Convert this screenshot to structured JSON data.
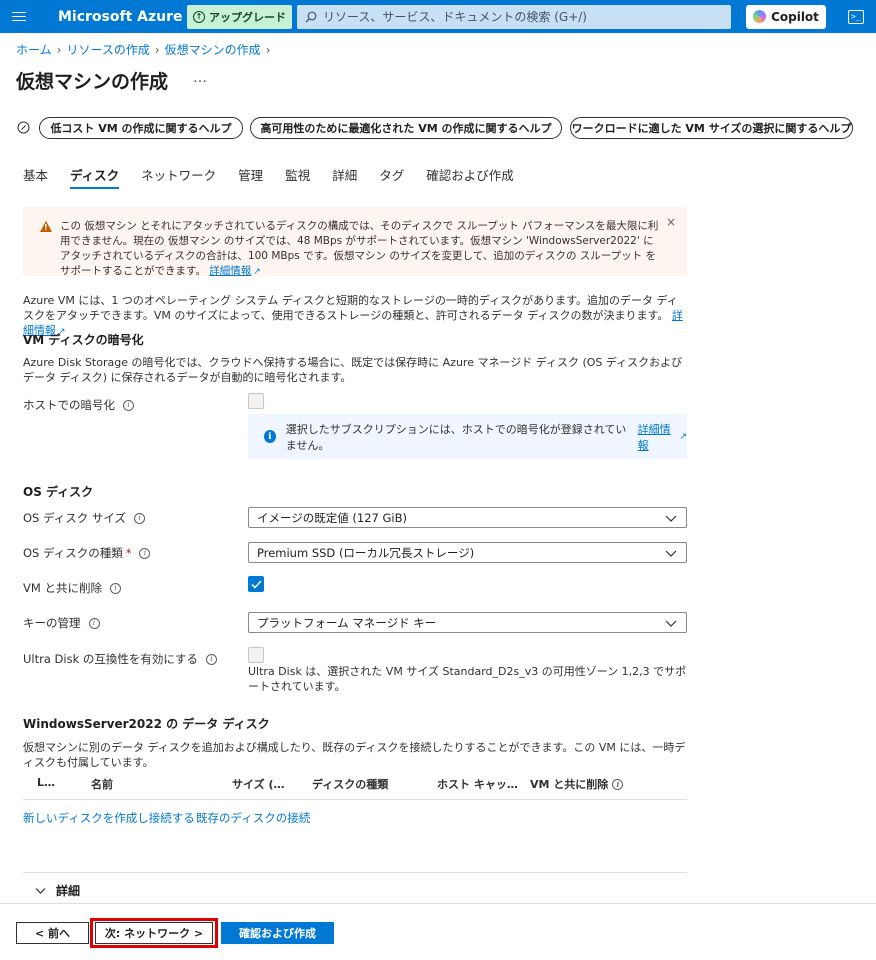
{
  "topbar": {
    "brand": "Microsoft Azure",
    "upgrade_label": "アップグレード",
    "search_placeholder": "リソース、サービス、ドキュメントの検索 (G+/)",
    "copilot_label": "Copilot",
    "terminal_glyph": ">_"
  },
  "breadcrumb": [
    "ホーム",
    "リソースの作成",
    "仮想マシンの作成"
  ],
  "page": {
    "title": "仮想マシンの作成",
    "more": "…"
  },
  "help_pills": [
    "低コスト VM の作成に関するヘルプ",
    "高可用性のために最適化された VM の作成に関するヘルプ",
    "ワークロードに適した VM サイズの選択に関するヘルプ"
  ],
  "tabs": [
    "基本",
    "ディスク",
    "ネットワーク",
    "管理",
    "監視",
    "詳細",
    "タグ",
    "確認および作成"
  ],
  "active_tab": "ディスク",
  "warning": {
    "text": "この 仮想マシン とそれにアタッチされているディスクの構成では、そのディスクで スループット パフォーマンスを最大限に利用できません。現在の 仮想マシン のサイズでは、48 MBps がサポートされています。仮想マシン 'WindowsServer2022' にアタッチされているディスクの合計は、100 MBps です。仮想マシン のサイズを変更して、追加のディスクの スループット をサポートすることができます。",
    "link": "詳細情報",
    "close": "×"
  },
  "intro": {
    "text": "Azure VM には、1 つのオペレーティング システム ディスクと短期的なストレージの一時的ディスクがあります。追加のデータ ディスクをアタッチできます。VM のサイズによって、使用できるストレージの種類と、許可されるデータ ディスクの数が決まります。",
    "link": "詳細情報"
  },
  "encryption": {
    "heading": "VM ディスクの暗号化",
    "text": "Azure Disk Storage の暗号化では、クラウドへ保持する場合に、既定では保存時に Azure マネージド ディスク (OS ディスクおよびデータ ディスク) に保存されるデータが自動的に暗号化されます。",
    "host_label": "ホストでの暗号化",
    "host_checked": false,
    "info_text": "選択したサブスクリプションには、ホストでの暗号化が登録されていません。",
    "info_link": "詳細情報"
  },
  "os_disk": {
    "heading": "OS ディスク",
    "size_label": "OS ディスク サイズ",
    "size_value": "イメージの既定値 (127 GiB)",
    "type_label": "OS ディスクの種類",
    "type_required": "*",
    "type_value": "Premium SSD (ローカル冗長ストレージ)",
    "delete_label": "VM と共に削除",
    "delete_checked": true,
    "key_label": "キーの管理",
    "key_value": "プラットフォーム マネージド キー",
    "ultra_label": "Ultra Disk の互換性を有効にする",
    "ultra_note": "Ultra Disk は、選択された VM サイズ Standard_D2s_v3 の可用性ゾーン 1,2,3 でサポートされています。"
  },
  "data_disks": {
    "heading": "WindowsServer2022 の データ ディスク",
    "text": "仮想マシンに別のデータ ディスクを追加および構成したり、既存のディスクを接続したりすることができます。この VM には、一時ディスクも付属しています。",
    "columns": [
      "L…",
      "名前",
      "サイズ (…",
      "ディスクの種類",
      "ホスト キャッ…",
      "VM と共に削除"
    ],
    "create_link": "新しいディスクを作成し接続する",
    "attach_link": "既存のディスクの接続"
  },
  "advanced": {
    "label": "詳細"
  },
  "footer": {
    "prev": "< 前へ",
    "next": "次: ネットワーク >",
    "review": "確認および作成"
  }
}
